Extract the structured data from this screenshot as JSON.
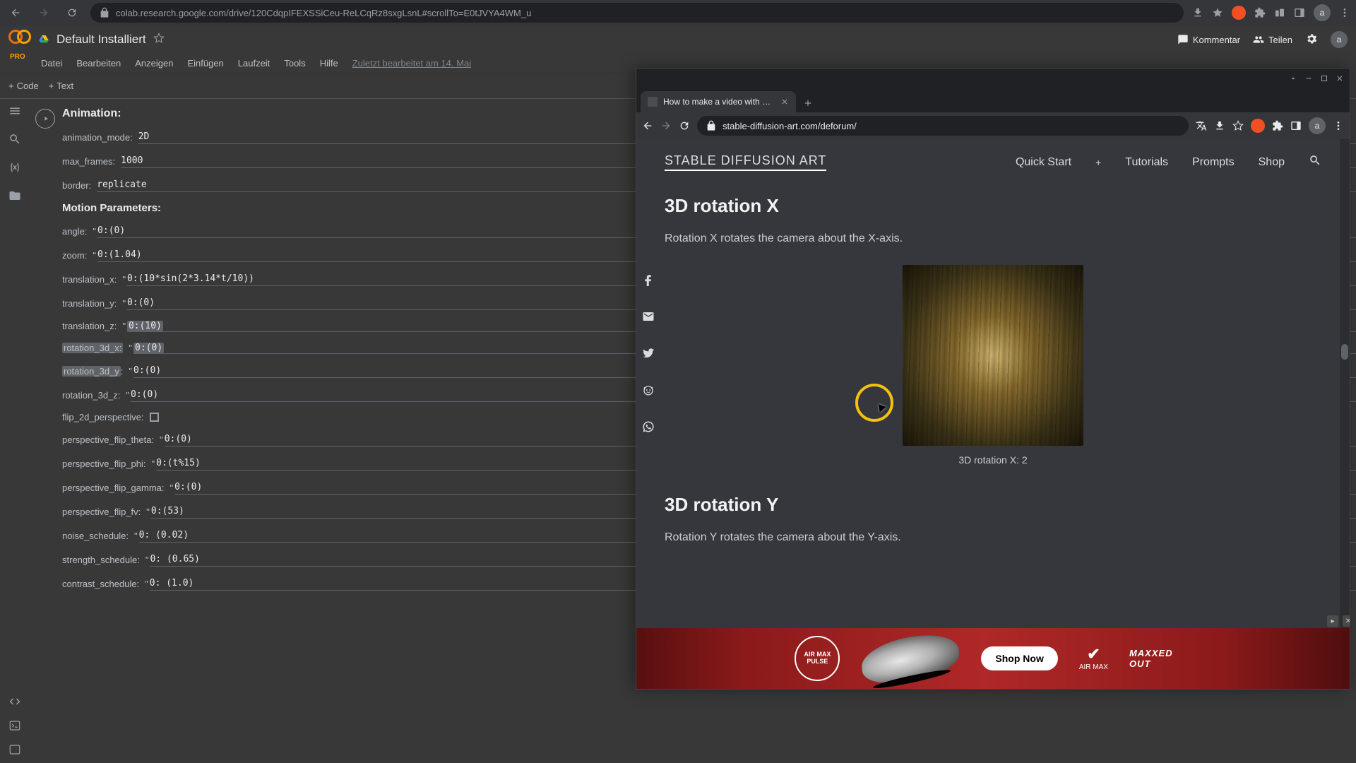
{
  "browser": {
    "url": "colab.research.google.com/drive/120CdqpIFEXSSiCeu-ReLCqRz8sxgLsnL#scrollTo=E0tJVYA4WM_u"
  },
  "colab": {
    "pro_label": "PRO",
    "title": "Default Installiert",
    "menu": [
      "Datei",
      "Bearbeiten",
      "Anzeigen",
      "Einfügen",
      "Laufzeit",
      "Tools",
      "Hilfe"
    ],
    "edited": "Zuletzt bearbeitet am 14. Mai",
    "toolbar": {
      "code": "Code",
      "text": "Text"
    },
    "header_right": {
      "comment": "Kommentar",
      "share": "Teilen",
      "avatar": "a"
    }
  },
  "animation": {
    "title": "Animation:",
    "rows": [
      {
        "label": "animation_mode:",
        "value": "2D",
        "quote": false
      },
      {
        "label": "max_frames:",
        "value": "1000",
        "quote": false
      },
      {
        "label": "border:",
        "value": "replicate",
        "quote": false
      }
    ]
  },
  "motion": {
    "title": "Motion Parameters:",
    "rows": [
      {
        "label": "angle:",
        "value": "0:(0)"
      },
      {
        "label": "zoom:",
        "value": "0:(1.04)"
      },
      {
        "label": "translation_x:",
        "value": "0:(10*sin(2*3.14*t/10))"
      },
      {
        "label": "translation_y:",
        "value": "0:(0)"
      },
      {
        "label": "translation_z:",
        "value": "0:(10)",
        "hl": true
      },
      {
        "label": "rotation_3d_x:",
        "value": "0:(0)",
        "hl": true,
        "hlLabel": true
      },
      {
        "label": "rotation_3d_y:",
        "value": "0:(0)",
        "hlLabelPartial": true
      },
      {
        "label": "rotation_3d_z:",
        "value": "0:(0)"
      },
      {
        "label": "flip_2d_perspective:",
        "checkbox": true
      },
      {
        "label": "perspective_flip_theta:",
        "value": "0:(0)"
      },
      {
        "label": "perspective_flip_phi:",
        "value": "0:(t%15)"
      },
      {
        "label": "perspective_flip_gamma:",
        "value": "0:(0)"
      },
      {
        "label": "perspective_flip_fv:",
        "value": "0:(53)"
      },
      {
        "label": "noise_schedule:",
        "value": "0: (0.02)"
      },
      {
        "label": "strength_schedule:",
        "value": "0: (0.65)"
      },
      {
        "label": "contrast_schedule:",
        "value": "0: (1.0)"
      }
    ]
  },
  "right_window": {
    "tab_title": "How to make a video with Stabl…",
    "url": "stable-diffusion-art.com/deforum/",
    "brand": "STABLE DIFFUSION ART",
    "nav": [
      "Quick Start",
      "Tutorials",
      "Prompts",
      "Shop"
    ],
    "h2_1": "3D rotation X",
    "p1": "Rotation X rotates the camera about the X-axis.",
    "caption1": "3D rotation X: 2",
    "h2_2": "3D rotation Y",
    "p2": "Rotation Y rotates the camera about the Y-axis.",
    "ad": {
      "shop": "Shop Now",
      "logo": "AIR MAX\nPULSE",
      "maxxed": "MAXXED\nOUT",
      "nike": "AIR MAX"
    }
  }
}
